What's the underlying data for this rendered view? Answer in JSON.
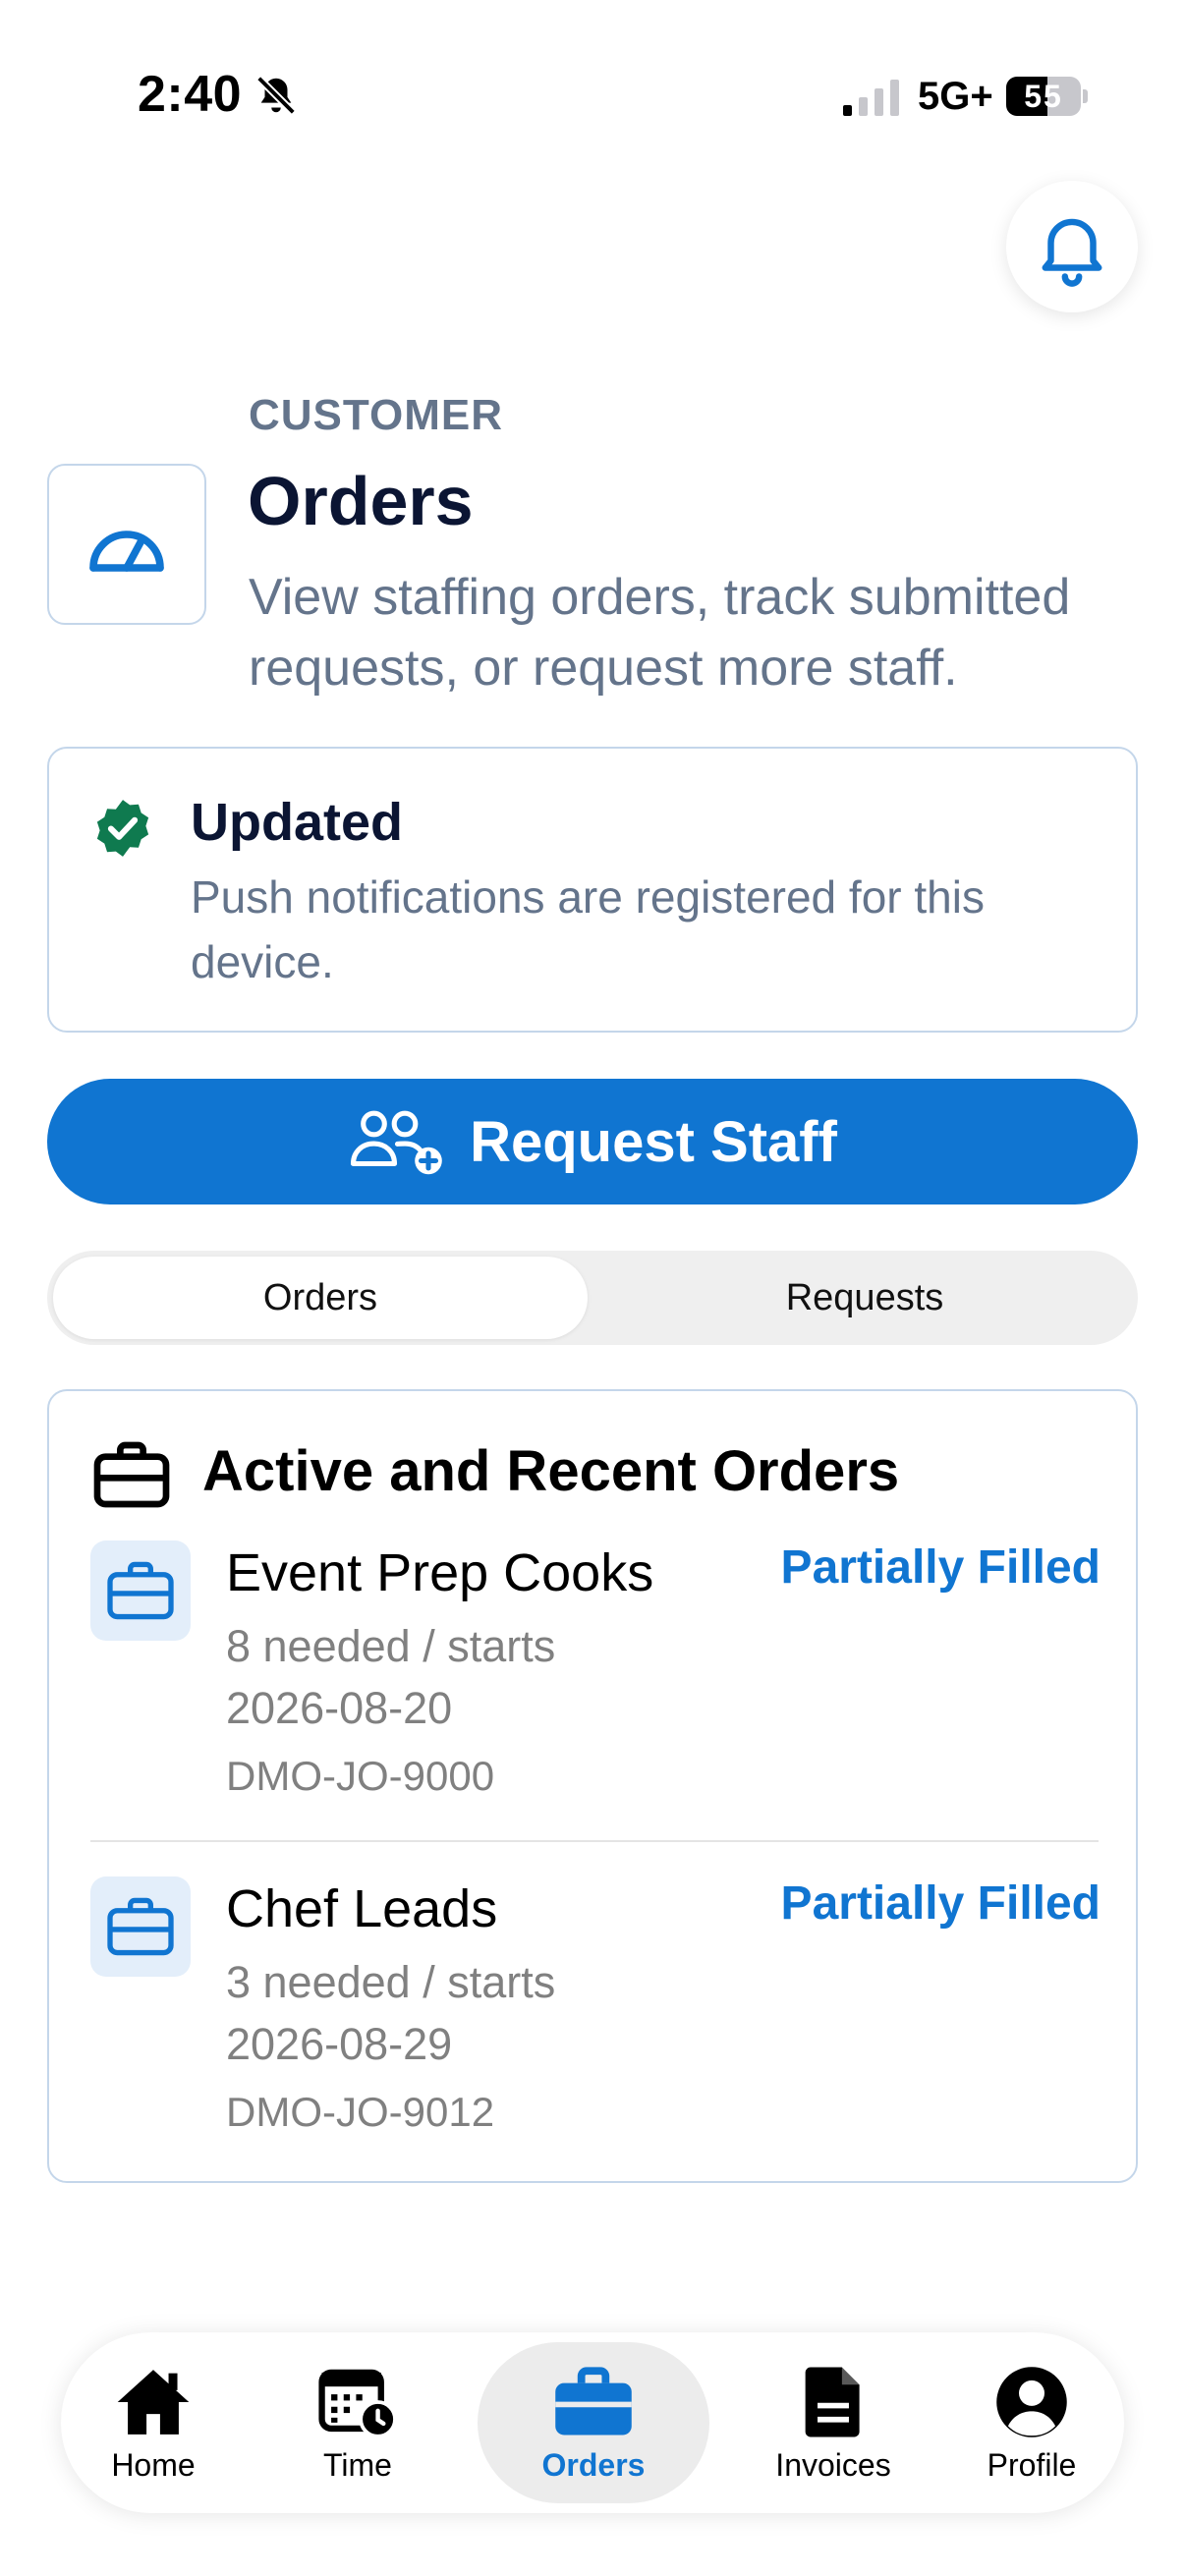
{
  "status_bar": {
    "time": "2:40",
    "network": "5G+",
    "battery": "55"
  },
  "header": {
    "eyebrow": "CUSTOMER",
    "title": "Orders",
    "subtitle": "View staffing orders, track submitted requests, or request more staff."
  },
  "notice": {
    "title": "Updated",
    "body": "Push notifications are registered for this device."
  },
  "request_button": {
    "label": "Request Staff"
  },
  "segments": {
    "orders": "Orders",
    "requests": "Requests",
    "selected": "Orders"
  },
  "orders_card": {
    "heading": "Active and Recent Orders",
    "orders": [
      {
        "title": "Event Prep Cooks",
        "status": "Partially Filled",
        "meta": "8 needed / starts 2026-08-20",
        "code": "DMO-JO-9000"
      },
      {
        "title": "Chef Leads",
        "status": "Partially Filled",
        "meta": "3 needed / starts 2026-08-29",
        "code": "DMO-JO-9012"
      }
    ]
  },
  "tabs": {
    "home": "Home",
    "time": "Time",
    "orders": "Orders",
    "invoices": "Invoices",
    "profile": "Profile",
    "active": "Orders"
  },
  "colors": {
    "accent": "#1075d1",
    "success": "#0f7a4f",
    "muted_text": "#64748b",
    "card_border": "#c4d6ea"
  },
  "icons": {
    "bell": "bell-icon",
    "header": "speedometer-icon",
    "notice": "verified-check-icon",
    "request": "users-add-icon",
    "orders_heading": "briefcase-icon",
    "order_row": "briefcase-icon"
  }
}
